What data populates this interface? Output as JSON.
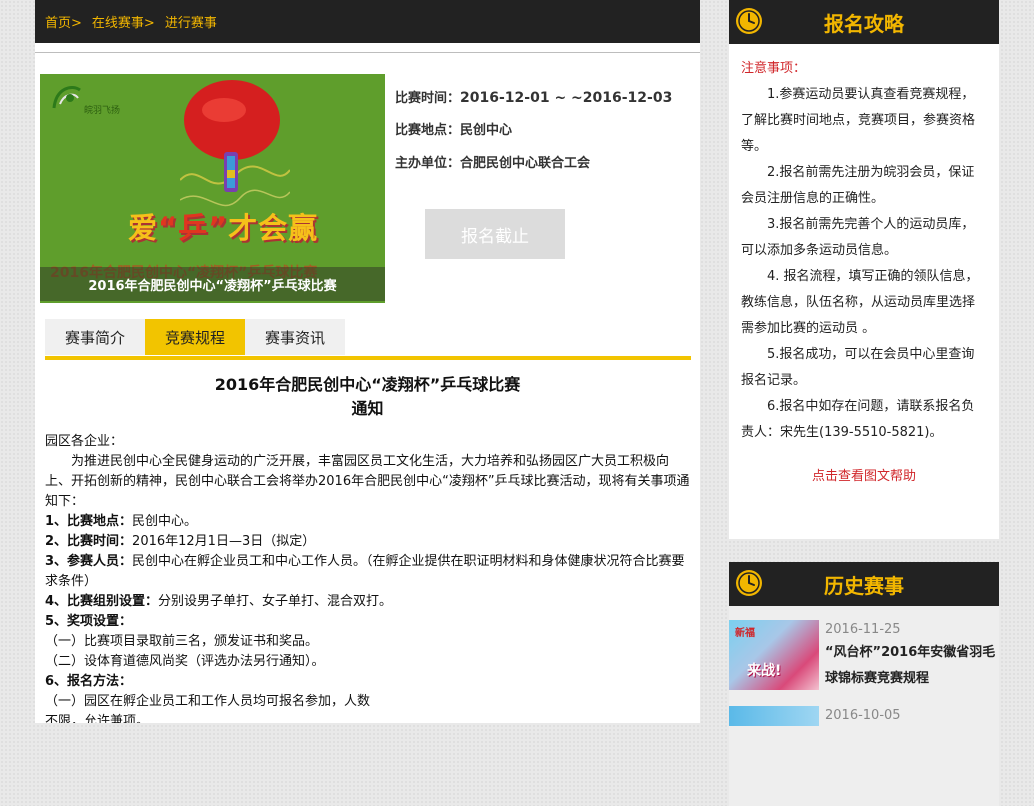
{
  "breadcrumb": {
    "home": "首页>",
    "online": "在线赛事>",
    "current": "进行赛事"
  },
  "poster": {
    "logo_text": "皖羽飞扬",
    "slogan_a": "爱",
    "slogan_q": "“乒”",
    "slogan_b": "才会赢",
    "band_text": "2016年合肥民创中心“凌翔杯”乒乓球比赛",
    "ghost_text": "2016年合肥民创中心“凌翔杯”乒乓球比赛"
  },
  "event_info": {
    "time_label": "比赛时间：",
    "time_value": "2016-12-01 ~ ~2016-12-03",
    "place_label": "比赛地点：",
    "place_value": "民创中心",
    "host_label": "主办单位：",
    "host_value": "合肥民创中心联合工会",
    "register_button": "报名截止"
  },
  "tabs": [
    {
      "label": "赛事简介"
    },
    {
      "label": "竞赛规程"
    },
    {
      "label": "赛事资讯"
    }
  ],
  "article": {
    "title": "2016年合肥民创中心“凌翔杯”乒乓球比赛",
    "subtitle": "通知",
    "greeting": "园区各企业：",
    "intro": "为推进民创中心全民健身运动的广泛开展，丰富园区员工文化生活，大力培养和弘扬园区广大员工积极向上、开拓创新的精神，民创中心联合工会将举办2016年合肥民创中心“凌翔杯”乒乓球比赛活动，现将有关事项通知下：",
    "item1_label": "1、比赛地点：",
    "item1_text": "民创中心。",
    "item2_label": "2、比赛时间：",
    "item2_text": "2016年12月1日—3日（拟定）",
    "item3_label": "3、参赛人员：",
    "item3_text": "民创中心在孵企业员工和中心工作人员。（在孵企业提供在职证明材料和身体健康状况符合比赛要求条件）",
    "item4_label": "4、比赛组别设置：",
    "item4_text": "分别设男子单打、女子单打、混合双打。",
    "item5_label": "5、奖项设置：",
    "item5_a": "（一）比赛项目录取前三名，颁发证书和奖品。",
    "item5_b": "（二）设体育道德风尚奖（评选办法另行通知）。",
    "item6_label": "6、报名方法：",
    "item6_a": "（一）园区在孵企业员工和工作人员均可报名参加，人数",
    "item6_b": "不限，允许兼项。"
  },
  "guide": {
    "title": "报名攻略",
    "note": "注意事项：",
    "tips": [
      "1.参赛运动员要认真查看竞赛规程，了解比赛时间地点，竞赛项目，参赛资格等。",
      "2.报名前需先注册为皖羽会员，保证会员注册信息的正确性。",
      "3.报名前需先完善个人的运动员库，可以添加多条运动员信息。",
      "4. 报名流程，填写正确的领队信息，教练信息，队伍名称，从运动员库里选择需参加比赛的运动员 。",
      "5.报名成功，可以在会员中心里查询报名记录。",
      "6.报名中如存在问题，请联系报名负责人：宋先生(139-5510-5821)。"
    ],
    "help_link": "点击查看图文帮助"
  },
  "history": {
    "title": "历史赛事",
    "items": [
      {
        "date": "2016-11-25",
        "name": "“风台杯”2016年安徽省羽毛球锦标赛竞赛规程",
        "thumb_top": "新福",
        "thumb_text": "来战!"
      },
      {
        "date": "2016-10-05"
      }
    ]
  },
  "colors": {
    "accent": "#f2c400",
    "dark": "#222222",
    "red": "#d0262a",
    "poster_green": "#5f9e2c"
  },
  "icons": {
    "clock": "clock-icon"
  }
}
